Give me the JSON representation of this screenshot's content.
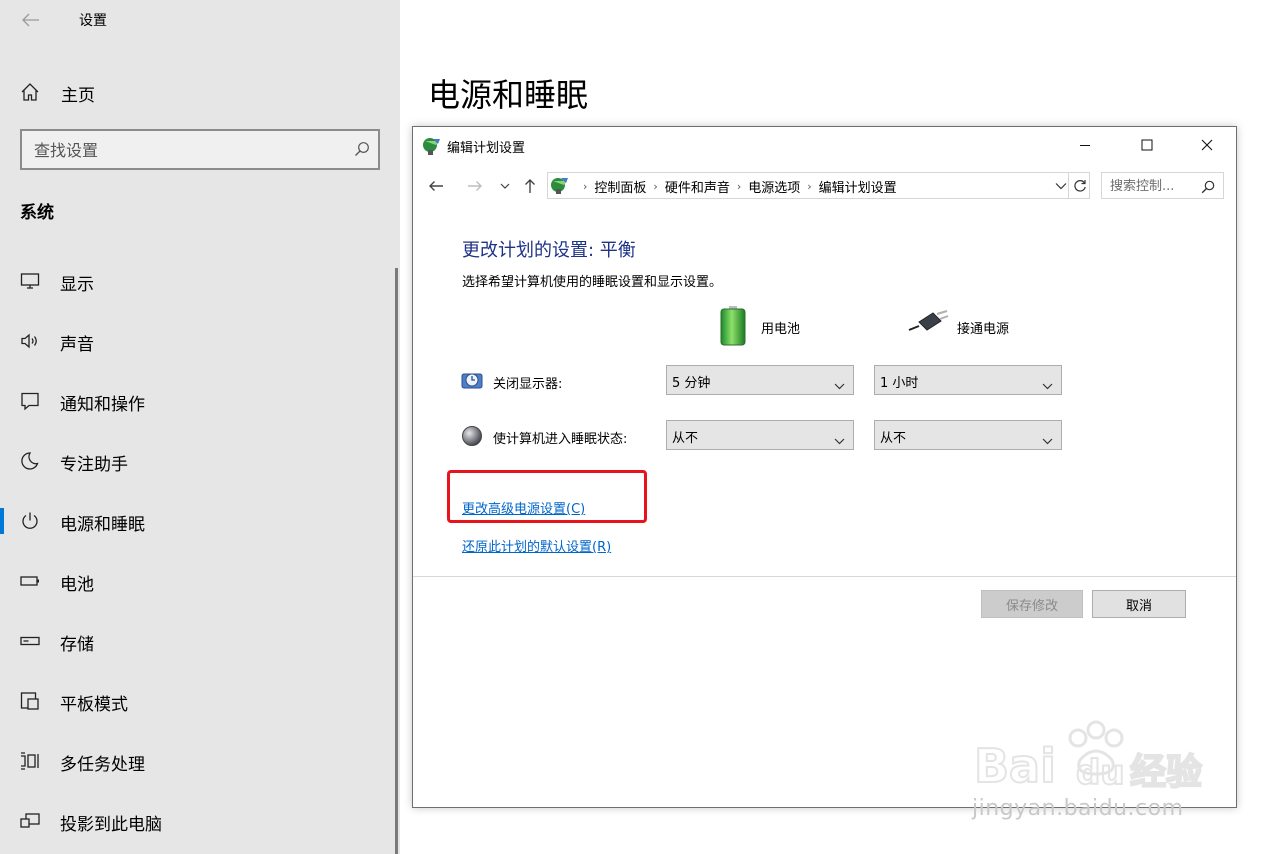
{
  "settings": {
    "app_title": "设置",
    "home_label": "主页",
    "search_placeholder": "查找设置",
    "section_title": "系统",
    "nav_items": [
      {
        "label": "显示",
        "icon": "monitor-icon"
      },
      {
        "label": "声音",
        "icon": "speaker-icon"
      },
      {
        "label": "通知和操作",
        "icon": "notification-icon"
      },
      {
        "label": "专注助手",
        "icon": "moon-icon"
      },
      {
        "label": "电源和睡眠",
        "icon": "power-icon",
        "active": true
      },
      {
        "label": "电池",
        "icon": "battery-icon"
      },
      {
        "label": "存储",
        "icon": "storage-icon"
      },
      {
        "label": "平板模式",
        "icon": "tablet-mode-icon"
      },
      {
        "label": "多任务处理",
        "icon": "multitasking-icon"
      },
      {
        "label": "投影到此电脑",
        "icon": "project-icon"
      }
    ],
    "page_title": "电源和睡眠"
  },
  "dialog": {
    "title": "编辑计划设置",
    "breadcrumbs": [
      "控制面板",
      "硬件和声音",
      "电源选项",
      "编辑计划设置"
    ],
    "search_placeholder": "搜索控制...",
    "heading": "更改计划的设置: 平衡",
    "description": "选择希望计算机使用的睡眠设置和显示设置。",
    "col_battery": "用电池",
    "col_plugged": "接通电源",
    "rows": [
      {
        "label": "关闭显示器:",
        "battery": "5 分钟",
        "plugged": "1 小时",
        "icon": "display-clock-icon"
      },
      {
        "label": "使计算机进入睡眠状态:",
        "battery": "从不",
        "plugged": "从不",
        "icon": "sleep-moon-icon"
      }
    ],
    "link_advanced": "更改高级电源设置(C)",
    "link_restore": "还原此计划的默认设置(R)",
    "btn_save": "保存修改",
    "btn_cancel": "取消",
    "colors": {
      "highlight": "#e8141b",
      "link": "#0066cc",
      "heading": "#1e3287"
    }
  },
  "watermark": {
    "brand": "Bai du 经验",
    "url": "jingyan.baidu.com"
  }
}
